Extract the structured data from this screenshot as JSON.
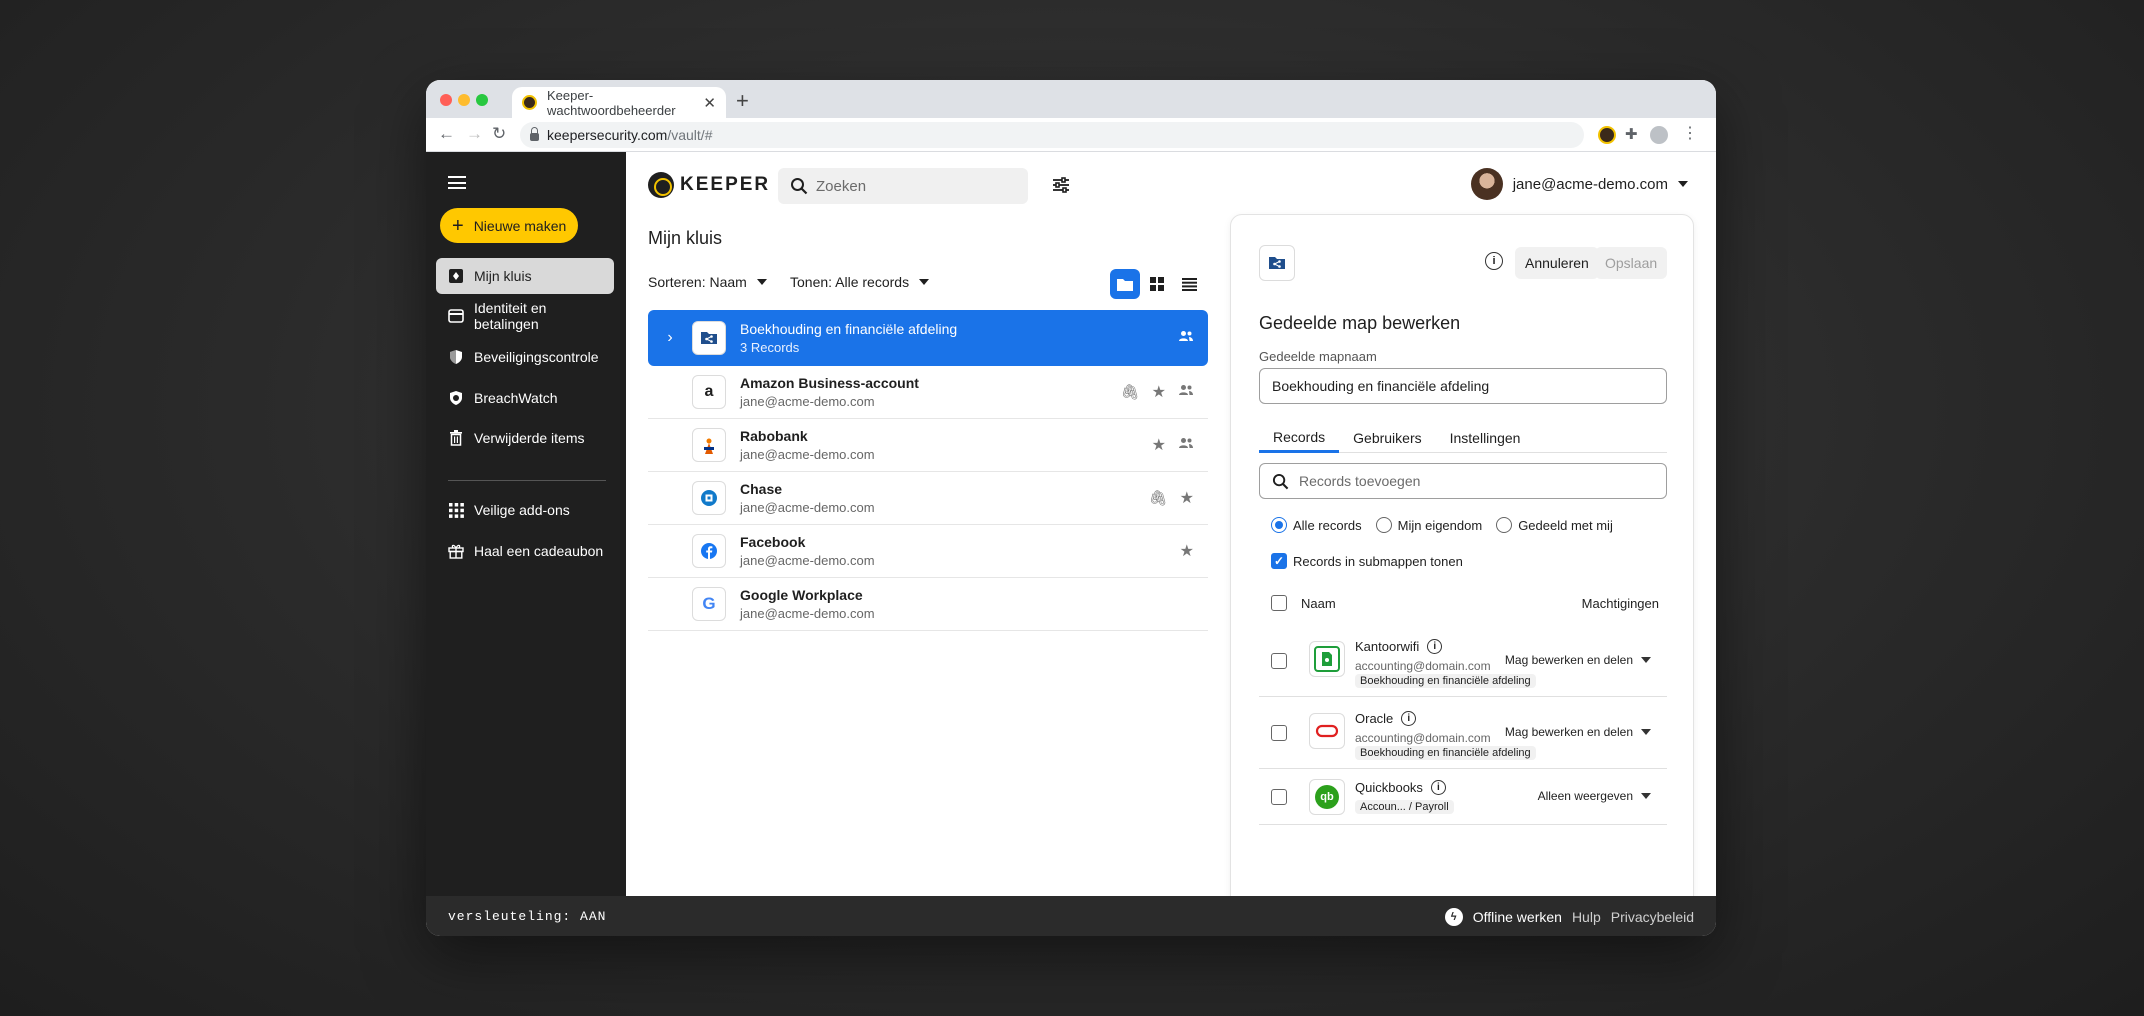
{
  "browser": {
    "tab_title": "Keeper-wachtwoordbeheerder",
    "tab_close": "✕",
    "new_tab": "+",
    "url_host": "keepersecurity.com",
    "url_path": "/vault/#"
  },
  "sidebar": {
    "new_button": "Nieuwe maken",
    "items": [
      {
        "label": "Mijn kluis",
        "icon": "vault-icon"
      },
      {
        "label": "Identiteit en betalingen",
        "icon": "card-icon"
      },
      {
        "label": "Beveiligingscontrole",
        "icon": "shield-icon"
      },
      {
        "label": "BreachWatch",
        "icon": "breachwatch-icon"
      },
      {
        "label": "Verwijderde items",
        "icon": "trash-icon"
      },
      {
        "label": "Veilige add-ons",
        "icon": "grid-icon"
      },
      {
        "label": "Haal een cadeaubon",
        "icon": "gift-icon"
      }
    ]
  },
  "header": {
    "logo_text": "KEEPER",
    "search_placeholder": "Zoeken",
    "user_email": "jane@acme-demo.com"
  },
  "vault": {
    "title": "Mijn kluis",
    "sort_label": "Sorteren: Naam",
    "show_label": "Tonen: Alle records",
    "records": [
      {
        "title": "Boekhouding en financiële afdeling",
        "subtitle": "3 Records",
        "selected": true
      },
      {
        "title": "Amazon Business-account",
        "subtitle": "jane@acme-demo.com",
        "logo": "a"
      },
      {
        "title": "Rabobank",
        "subtitle": "jane@acme-demo.com"
      },
      {
        "title": "Chase",
        "subtitle": "jane@acme-demo.com"
      },
      {
        "title": "Facebook",
        "subtitle": "jane@acme-demo.com"
      },
      {
        "title": "Google Workplace",
        "subtitle": "jane@acme-demo.com",
        "logo": "G"
      }
    ]
  },
  "panel": {
    "cancel": "Annuleren",
    "save": "Opslaan",
    "title": "Gedeelde map bewerken",
    "folder_label": "Gedeelde mapnaam",
    "folder_value": "Boekhouding en financiële afdeling",
    "tabs": [
      "Records",
      "Gebruikers",
      "Instellingen"
    ],
    "search_placeholder": "Records toevoegen",
    "radio": [
      "Alle records",
      "Mijn eigendom",
      "Gedeeld met mij"
    ],
    "show_sub": "Records in submappen tonen",
    "col_name": "Naam",
    "col_perm": "Machtigingen",
    "rows": [
      {
        "name": "Kantoorwifi",
        "email": "accounting@domain.com",
        "tag": "Boekhouding en financiële afdeling",
        "perm": "Mag bewerken en delen"
      },
      {
        "name": "Oracle",
        "email": "accounting@domain.com",
        "tag": "Boekhouding en financiële afdeling",
        "perm": "Mag bewerken en delen"
      },
      {
        "name": "Quickbooks",
        "tag": "Accoun... / Payroll",
        "perm": "Alleen weergeven",
        "logo": "qb"
      }
    ]
  },
  "footer": {
    "encryption": "versleuteling: AAN",
    "offline": "Offline werken",
    "help": "Hulp",
    "privacy": "Privacybeleid"
  },
  "colors": {
    "accent": "#1a73e8",
    "brand_yellow": "#ffc800",
    "sidebar_bg": "#1f1f1f"
  }
}
